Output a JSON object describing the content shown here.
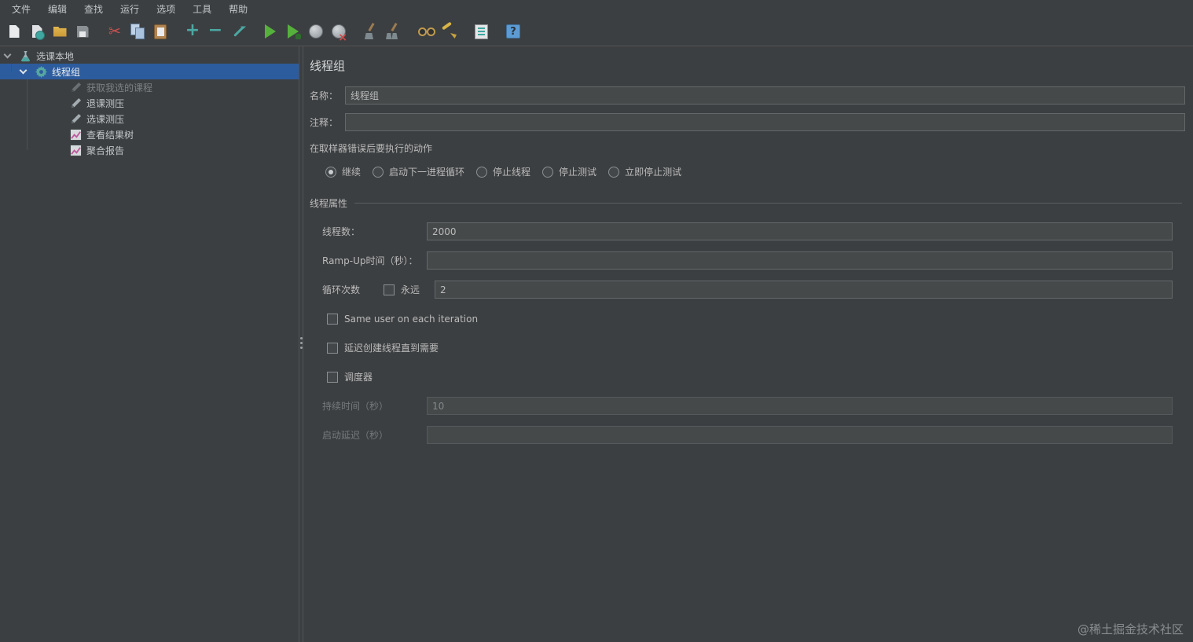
{
  "menu": {
    "items": [
      "文件",
      "编辑",
      "查找",
      "运行",
      "选项",
      "工具",
      "帮助"
    ]
  },
  "toolbar": {
    "icons": [
      "new-file",
      "templates",
      "open",
      "save",
      "cut",
      "copy",
      "paste",
      "zoom-in",
      "zoom-out",
      "edit",
      "start",
      "start-no-pauses",
      "stop",
      "shutdown",
      "clear",
      "clear-all",
      "search",
      "clear-search",
      "function-helper",
      "help"
    ]
  },
  "tree": {
    "items": [
      {
        "label": "选课本地",
        "type": "test-plan",
        "level": 0,
        "expanded": true,
        "selected": false,
        "disabled": false
      },
      {
        "label": "线程组",
        "type": "thread-group",
        "level": 1,
        "expanded": true,
        "selected": true,
        "disabled": false
      },
      {
        "label": "获取我选的课程",
        "type": "sampler",
        "level": 2,
        "selected": false,
        "disabled": true
      },
      {
        "label": "退课测压",
        "type": "sampler",
        "level": 2,
        "selected": false,
        "disabled": false
      },
      {
        "label": "选课测压",
        "type": "sampler",
        "level": 2,
        "selected": false,
        "disabled": false
      },
      {
        "label": "查看结果树",
        "type": "listener",
        "level": 2,
        "selected": false,
        "disabled": false
      },
      {
        "label": "聚合报告",
        "type": "listener",
        "level": 2,
        "selected": false,
        "disabled": false
      }
    ]
  },
  "panel": {
    "title": "线程组",
    "name_label": "名称：",
    "name_value": "线程组",
    "comment_label": "注释：",
    "comment_value": "",
    "error_action_label": "在取样器错误后要执行的动作",
    "error_actions": [
      {
        "label": "继续",
        "selected": true
      },
      {
        "label": "启动下一进程循环",
        "selected": false
      },
      {
        "label": "停止线程",
        "selected": false
      },
      {
        "label": "停止测试",
        "selected": false
      },
      {
        "label": "立即停止测试",
        "selected": false
      }
    ],
    "thread_props_label": "线程属性",
    "threads_label": "线程数：",
    "threads_value": "2000",
    "rampup_label": "Ramp-Up时间（秒）：",
    "rampup_value": "",
    "loop_label": "循环次数",
    "forever_label": "永远",
    "forever_checked": false,
    "loop_value": "2",
    "same_user_label": "Same user on each iteration",
    "same_user_checked": false,
    "delay_create_label": "延迟创建线程直到需要",
    "delay_create_checked": false,
    "scheduler_label": "调度器",
    "scheduler_checked": false,
    "duration_label": "持续时间（秒）",
    "duration_value": "10",
    "startup_delay_label": "启动延迟（秒）",
    "startup_delay_value": ""
  },
  "watermark": "@稀土掘金技术社区"
}
